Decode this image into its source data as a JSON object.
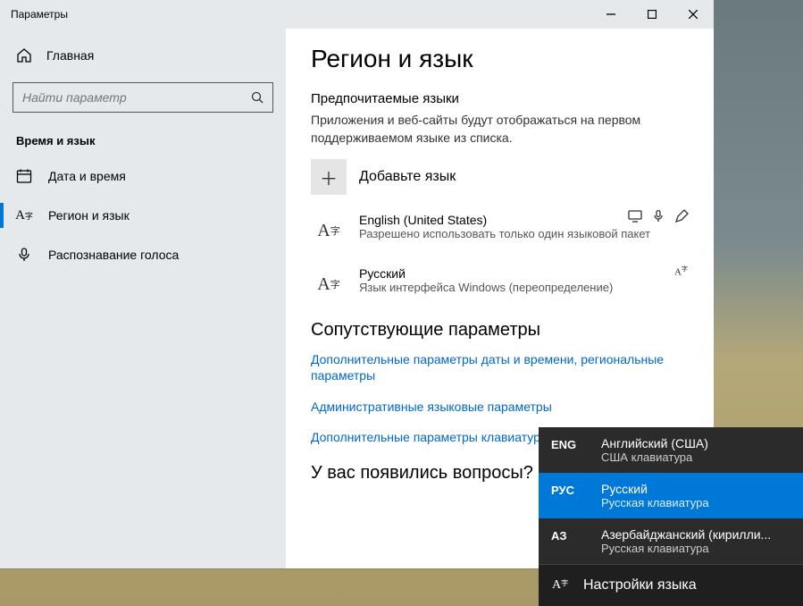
{
  "window": {
    "title": "Параметры"
  },
  "sidebar": {
    "home": "Главная",
    "search_placeholder": "Найти параметр",
    "group": "Время и язык",
    "items": [
      {
        "label": "Дата и время"
      },
      {
        "label": "Регион и язык"
      },
      {
        "label": "Распознавание голоса"
      }
    ]
  },
  "page": {
    "title": "Регион и язык",
    "pref_title": "Предпочитаемые языки",
    "pref_desc": "Приложения и веб-сайты будут отображаться на первом поддерживаемом языке из списка.",
    "add_lang": "Добавьте язык",
    "langs": [
      {
        "name": "English (United States)",
        "sub": "Разрешено использовать только один языковой пакет"
      },
      {
        "name": "Русский",
        "sub": "Язык интерфейса Windows (переопределение)"
      }
    ],
    "related_title": "Сопутствующие параметры",
    "links": [
      "Дополнительные параметры даты и времени, региональные параметры",
      "Административные языковые параметры",
      "Дополнительные параметры клавиатуры"
    ],
    "question": "У вас появились вопросы?"
  },
  "popup": {
    "items": [
      {
        "code": "ENG",
        "name": "Английский (США)",
        "kb": "США клавиатура",
        "selected": false
      },
      {
        "code": "РУС",
        "name": "Русский",
        "kb": "Русская клавиатура",
        "selected": true
      },
      {
        "code": "АЗ",
        "name": "Азербайджанский (кирилли...",
        "kb": "Русская клавиатура",
        "selected": false
      }
    ],
    "footer": "Настройки языка"
  }
}
